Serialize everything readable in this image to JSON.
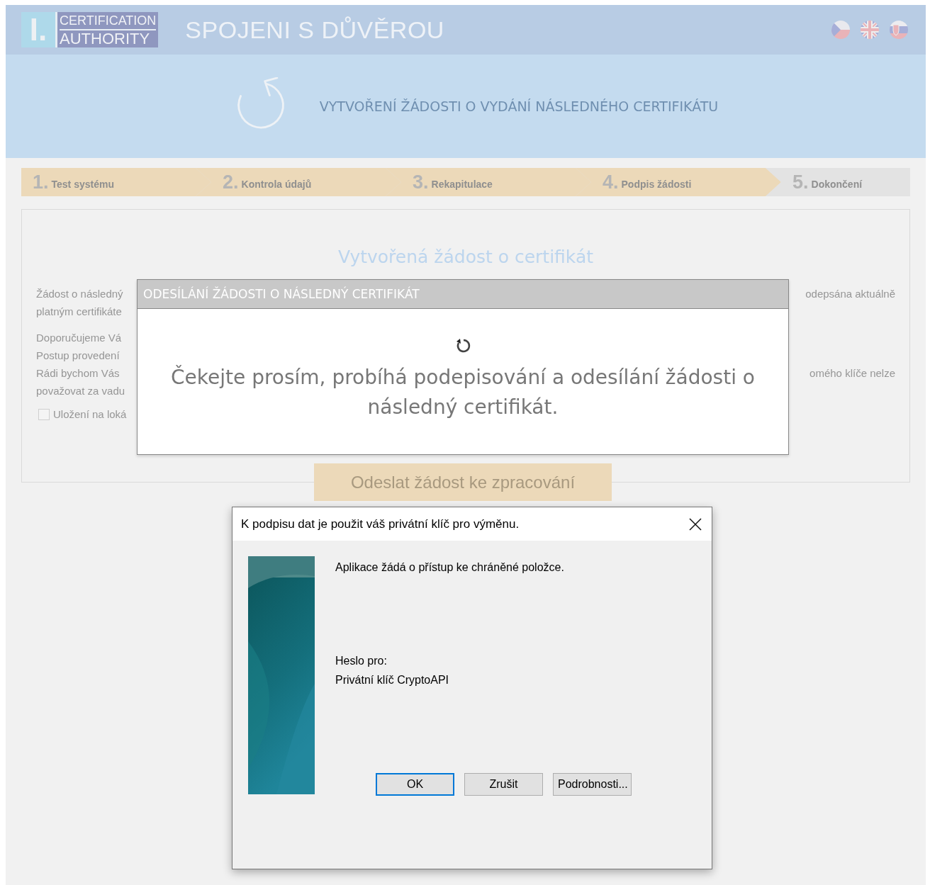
{
  "header": {
    "logo_mark": "I.",
    "logo_top": "CERTIFICATION",
    "logo_bottom": "AUTHORITY",
    "slogan": "SPOJENI S DŮVĚROU"
  },
  "banner": {
    "title": "VYTVOŘENÍ ŽÁDOSTI O VYDÁNÍ NÁSLEDNÉHO CERTIFIKÁTU"
  },
  "steps": [
    {
      "number": "1.",
      "label": "Test systému",
      "completed": true
    },
    {
      "number": "2.",
      "label": "Kontrola údajů",
      "completed": true
    },
    {
      "number": "3.",
      "label": "Rekapitulace",
      "completed": true
    },
    {
      "number": "4.",
      "label": "Podpis žádosti",
      "completed": true
    },
    {
      "number": "5.",
      "label": "Dokončení",
      "completed": false
    }
  ],
  "panel": {
    "title": "Vytvořená žádost o certifikát",
    "paragraphs": [
      {
        "lines": [
          {
            "left": "Žádost o následný",
            "right": "odepsána aktuálně"
          },
          {
            "left": "platným certifikáte"
          }
        ]
      },
      {
        "lines": [
          {
            "left": "Doporučujeme Vá"
          },
          {
            "left": "Postup provedení"
          },
          {
            "left": "Rádi bychom Vás",
            "right": "omého klíče nelze"
          },
          {
            "left": "považovat za vadu"
          }
        ]
      }
    ],
    "checkbox": {
      "label": "Uložení na loká",
      "checked": false
    },
    "submit_button": "Odeslat žádost ke zpracování"
  },
  "progress_modal": {
    "title": "ODESÍLÁNÍ ŽÁDOSTI O NÁSLEDNÝ CERTIFIKÁT",
    "message": "Čekejte prosím, probíhá podepisování a odesílání žádosti o následný certifikát."
  },
  "security_dialog": {
    "title": "K podpisu dat je použit váš privátní klíč pro výměnu.",
    "message": "Aplikace žádá o přístup ke chráněné položce.",
    "password_label": "Heslo pro:",
    "key_name": "Privátní klíč CryptoAPI",
    "buttons": [
      {
        "label": "OK",
        "default": true
      },
      {
        "label": "Zrušit",
        "default": false
      },
      {
        "label": "Podrobnosti...",
        "default": false
      }
    ]
  }
}
